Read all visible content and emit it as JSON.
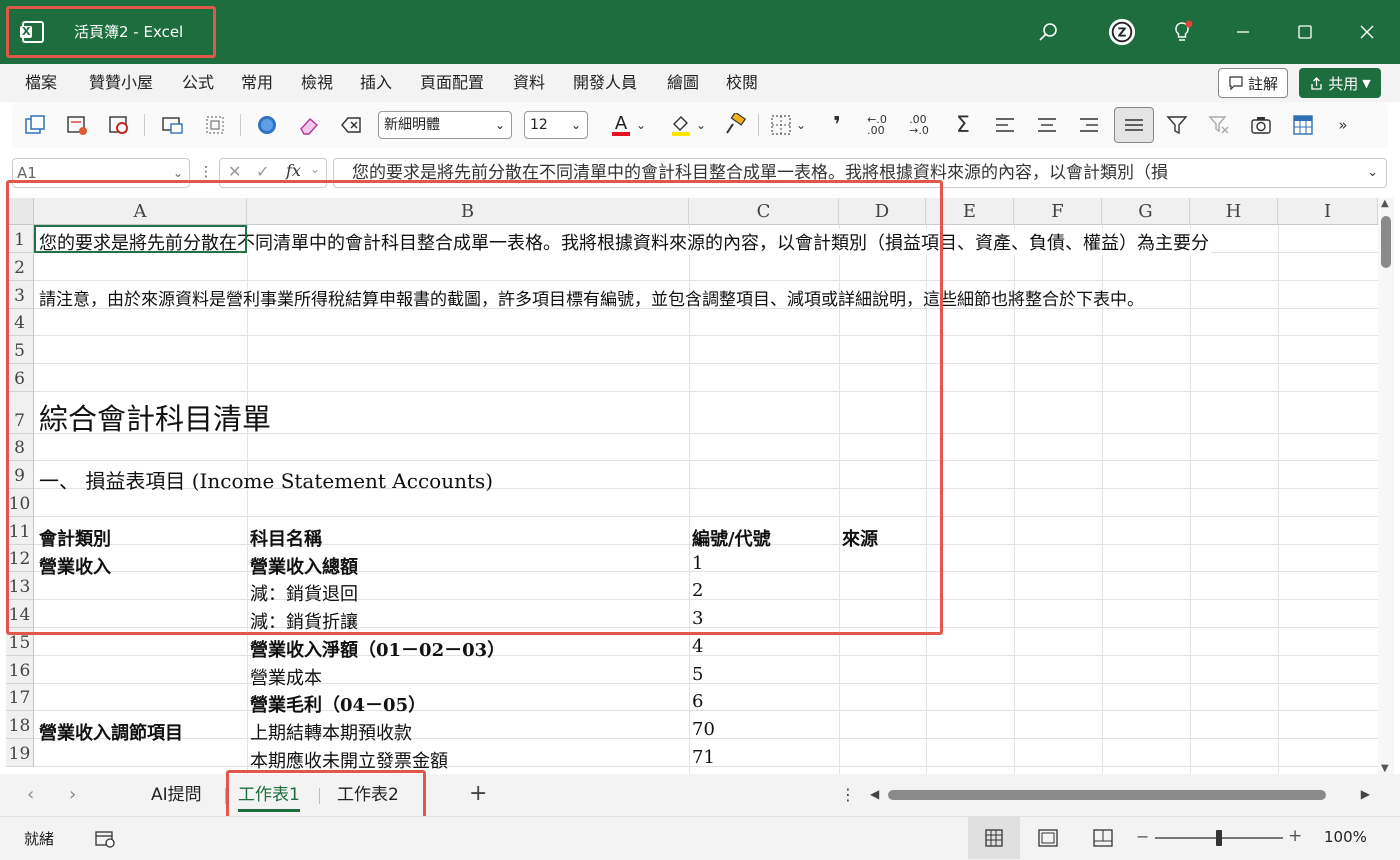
{
  "window": {
    "title": "活頁簿2 - Excel",
    "accent": "#1d6d3e"
  },
  "menu": [
    "檔案",
    "贊贊小屋",
    "公式",
    "常用",
    "檢視",
    "插入",
    "頁面配置",
    "資料",
    "開發人員",
    "繪圖",
    "校閱"
  ],
  "actions": {
    "comment": "註解",
    "share": "共用"
  },
  "ribbon": {
    "font": "新細明體",
    "size": "12"
  },
  "formula_bar": {
    "namebox": "A1",
    "fx": "fx",
    "content": "您的要求是將先前分散在不同清單中的會計科目整合成單一表格。我將根據資料來源的內容，以會計類別（損"
  },
  "columns": [
    "A",
    "B",
    "C",
    "D",
    "E",
    "F",
    "G",
    "H",
    "I"
  ],
  "rows": [
    "1",
    "2",
    "3",
    "4",
    "5",
    "6",
    "7",
    "8",
    "9",
    "10",
    "11",
    "12",
    "13",
    "14",
    "15",
    "16",
    "17",
    "18",
    "19"
  ],
  "cells": {
    "r1": "您的要求是將先前分散在不同清單中的會計科目整合成單一表格。我將根據資料來源的內容，以會計類別（損益項目、資產、負債、權益）為主要分",
    "r3": "請注意，由於來源資料是營利事業所得稅結算申報書的截圖，許多項目標有編號，並包含調整項目、減項或詳細說明，這些細節也將整合於下表中。",
    "r7": "綜合會計科目清單",
    "r9": "一、 損益表項目 (Income Statement Accounts)",
    "r11a": "會計類別",
    "r11b": "科目名稱",
    "r11c": "編號/代號",
    "r11d": "來源",
    "r12a": "營業收入",
    "r12b": "營業收入總額",
    "r12c": "1",
    "r13b": "減：銷貨退回",
    "r13c": "2",
    "r14b": "減：銷貨折讓",
    "r14c": "3",
    "r15b": "營業收入淨額（01－02－03）",
    "r15c": "4",
    "r16b": "營業成本",
    "r16c": "5",
    "r17b": "營業毛利（04－05）",
    "r17c": "6",
    "r18a": "營業收入調節項目",
    "r18b": "上期結轉本期預收款",
    "r18c": "70",
    "r19b": "本期應收未開立發票金額",
    "r19c": "71"
  },
  "sheets": [
    "AI提問",
    "工作表1",
    "工作表2"
  ],
  "active_sheet": "工作表1",
  "status": {
    "ready": "就緒",
    "zoom": "100%"
  }
}
